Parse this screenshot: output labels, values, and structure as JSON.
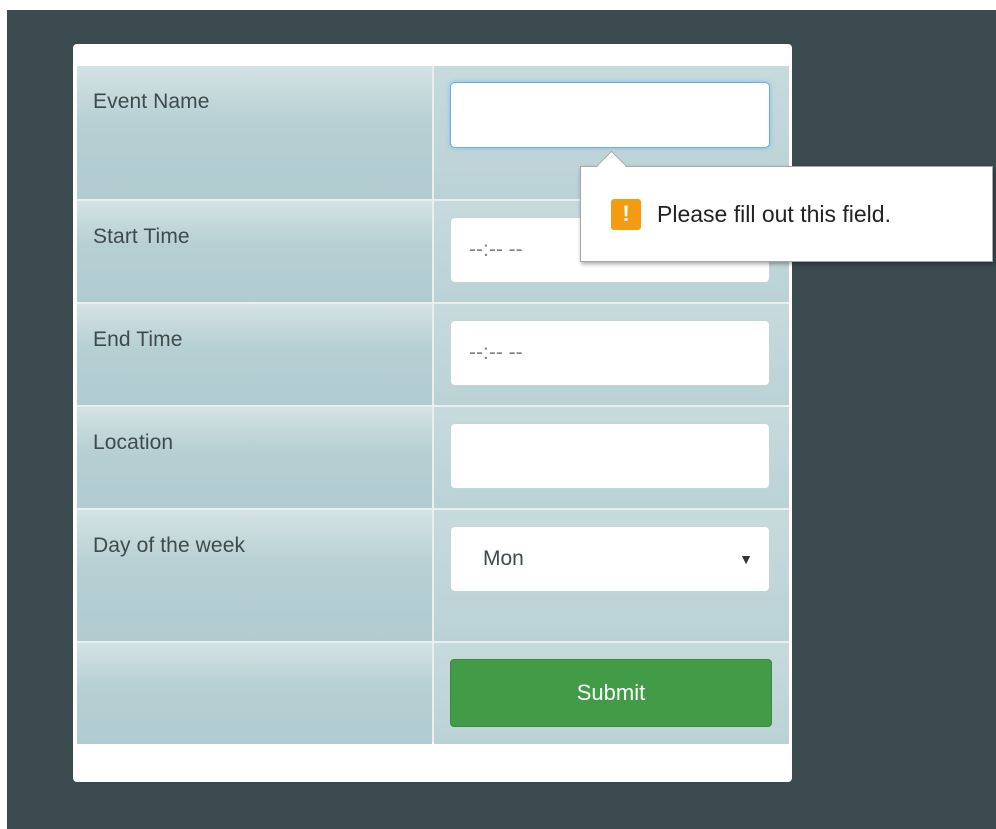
{
  "form": {
    "event_name": {
      "label": "Event Name",
      "value": ""
    },
    "start_time": {
      "label": "Start Time",
      "value": "--:-- --"
    },
    "end_time": {
      "label": "End Time",
      "value": "--:-- --"
    },
    "location": {
      "label": "Location",
      "value": ""
    },
    "day_of_week": {
      "label": "Day of the week",
      "selected": "Mon"
    },
    "submit_label": "Submit"
  },
  "validation_tooltip": {
    "icon": "warning-icon",
    "icon_glyph": "!",
    "message": "Please fill out this field."
  },
  "colors": {
    "backdrop": "#3a4a4f",
    "submit": "#419b47",
    "warning": "#f39c12",
    "focus": "#66afe9"
  }
}
